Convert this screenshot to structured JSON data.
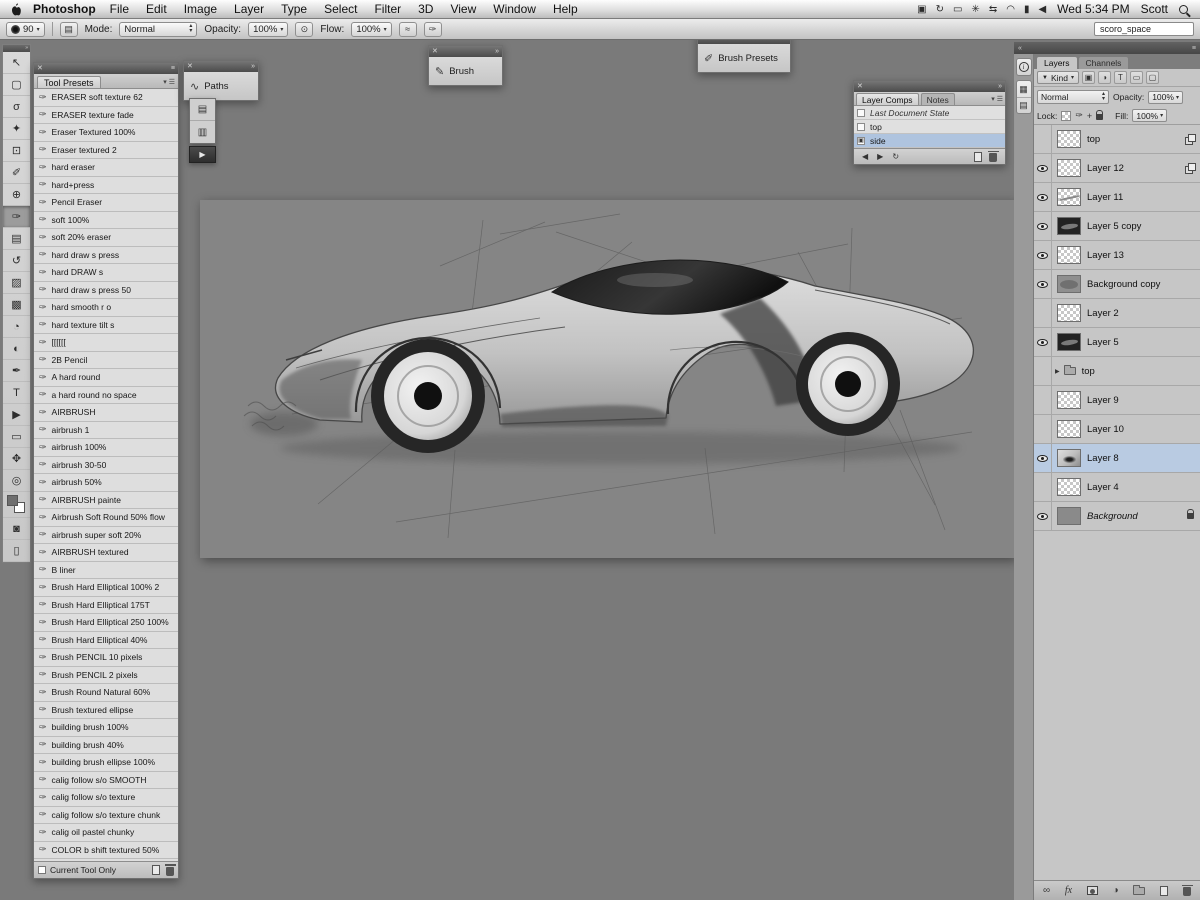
{
  "menu_bar": {
    "app_name": "Photoshop",
    "items": [
      "File",
      "Edit",
      "Image",
      "Layer",
      "Type",
      "Select",
      "Filter",
      "3D",
      "View",
      "Window",
      "Help"
    ],
    "status_icons": [
      {
        "glyph": "▣",
        "name": "display-icon"
      },
      {
        "glyph": "↻",
        "name": "time-machine-icon"
      },
      {
        "glyph": "▭",
        "name": "drive-icon"
      },
      {
        "glyph": "✳",
        "name": "settings-icon"
      },
      {
        "glyph": "⇆",
        "name": "sync-icon"
      },
      {
        "glyph": "◠",
        "name": "wifi-icon"
      },
      {
        "glyph": "▮",
        "name": "battery-icon"
      },
      {
        "glyph": "◀",
        "name": "volume-icon"
      }
    ],
    "clock": "Wed 5:34 PM",
    "user": "Scott"
  },
  "options_bar": {
    "brush_size": "90",
    "mode_label": "Mode:",
    "mode_value": "Normal",
    "opacity_label": "Opacity:",
    "opacity_value": "100%",
    "flow_label": "Flow:",
    "flow_value": "100%",
    "workspace": "scoro_space"
  },
  "tools": [
    {
      "glyph": "↖",
      "name": "move-tool"
    },
    {
      "glyph": "▢",
      "name": "marquee-tool"
    },
    {
      "glyph": "σ",
      "name": "lasso-tool"
    },
    {
      "glyph": "✦",
      "name": "quick-selection-tool"
    },
    {
      "glyph": "⊡",
      "name": "crop-tool"
    },
    {
      "glyph": "✐",
      "name": "eyedropper-tool"
    },
    {
      "glyph": "⊕",
      "name": "healing-brush-tool"
    },
    {
      "glyph": "✑",
      "name": "brush-tool",
      "selected": true
    },
    {
      "glyph": "▤",
      "name": "clone-stamp-tool"
    },
    {
      "glyph": "↺",
      "name": "history-brush-tool"
    },
    {
      "glyph": "▨",
      "name": "eraser-tool"
    },
    {
      "glyph": "▩",
      "name": "gradient-tool"
    },
    {
      "glyph": "◔",
      "name": "blur-tool"
    },
    {
      "glyph": "◐",
      "name": "dodge-tool"
    },
    {
      "glyph": "✒",
      "name": "pen-tool"
    },
    {
      "glyph": "T",
      "name": "type-tool"
    },
    {
      "glyph": "▶",
      "name": "path-selection-tool"
    },
    {
      "glyph": "▭",
      "name": "shape-tool"
    },
    {
      "glyph": "✥",
      "name": "hand-tool"
    },
    {
      "glyph": "◎",
      "name": "zoom-tool"
    }
  ],
  "tool_presets": {
    "title": "Tool Presets",
    "footer_checkbox": "Current Tool Only",
    "items": [
      "ERASER soft texture 62",
      "ERASER texture fade",
      "Eraser Textured 100%",
      "Eraser textured 2",
      "hard eraser",
      "hard+press",
      "Pencil Eraser",
      "soft 100%",
      "soft 20% eraser",
      "hard draw s press",
      "hard DRAW s",
      "hard draw s press 50",
      "hard smooth r o",
      "hard texture tilt s",
      "[[[[[[",
      "2B Pencil",
      "A hard round",
      "a hard round no space",
      "AIRBRUSH",
      "airbrush 1",
      "airbrush 100%",
      "airbrush 30-50",
      "airbrush 50%",
      "AIRBRUSH painte",
      "Airbrush Soft Round 50% flow",
      "airbrush super soft 20%",
      "AIRBRUSH textured",
      "B liner",
      "Brush Hard Elliptical 100% 2",
      "Brush Hard Elliptical 175T",
      "Brush Hard Elliptical 250 100%",
      "Brush Hard Elliptical 40%",
      "Brush PENCIL 10 pixels",
      "Brush PENCIL 2 pixels",
      "Brush Round Natural 60%",
      "Brush textured ellipse",
      "building brush 100%",
      "building brush 40%",
      "building brush ellipse 100%",
      "calig follow s/o SMOOTH",
      "calig follow s/o texture",
      "calig follow s/o texture chunk",
      "calig oil pastel chunky",
      "COLOR b shift textured 50%"
    ]
  },
  "floating_panels": {
    "paths": "Paths",
    "brush": "Brush",
    "brush_presets": "Brush Presets"
  },
  "layer_comps": {
    "tabs": [
      "Layer Comps",
      "Notes"
    ],
    "rows": [
      {
        "label": "Last Document State",
        "italic": true
      },
      {
        "label": "top"
      },
      {
        "label": "side",
        "selected": true
      }
    ]
  },
  "layers_panel": {
    "tabs": [
      "Layers",
      "Channels"
    ],
    "kind_label": "Kind",
    "blend_mode": "Normal",
    "opacity_label": "Opacity:",
    "opacity_value": "100%",
    "lock_label": "Lock:",
    "fill_label": "Fill:",
    "fill_value": "100%",
    "layers": [
      {
        "name": "top",
        "thumb": "checker",
        "eye": false,
        "badge": true
      },
      {
        "name": "Layer 12",
        "thumb": "checker",
        "eye": true,
        "badge": true
      },
      {
        "name": "Layer 11",
        "thumb": "sketch",
        "eye": true
      },
      {
        "name": "Layer 5 copy",
        "thumb": "dark",
        "eye": true
      },
      {
        "name": "Layer 13",
        "thumb": "checker",
        "eye": true
      },
      {
        "name": "Background copy",
        "thumb": "gray",
        "eye": true
      },
      {
        "name": "Layer 2",
        "thumb": "checker",
        "eye": false
      },
      {
        "name": "Layer 5",
        "thumb": "dark",
        "eye": true
      },
      {
        "name": "top",
        "thumb": "folder",
        "eye": false,
        "group": true
      },
      {
        "name": "Layer 9",
        "thumb": "checker",
        "eye": false
      },
      {
        "name": "Layer 10",
        "thumb": "checker",
        "eye": false
      },
      {
        "name": "Layer 8",
        "thumb": "car",
        "eye": true,
        "selected": true
      },
      {
        "name": "Layer 4",
        "thumb": "checker",
        "eye": false
      },
      {
        "name": "Background",
        "thumb": "solid",
        "eye": true,
        "locked": true,
        "italic": true
      }
    ]
  },
  "colors": {
    "selection_blue": "#b9cbe2",
    "canvas_gray": "#858585"
  }
}
